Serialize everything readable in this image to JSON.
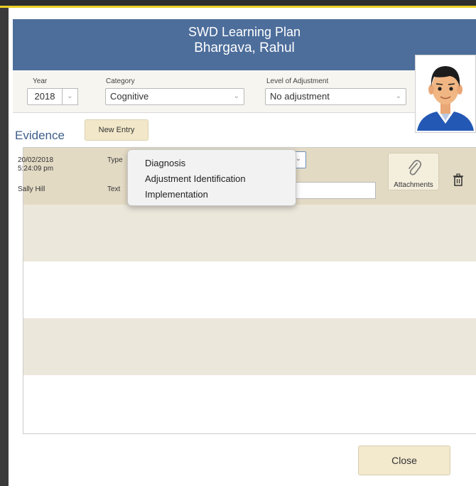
{
  "header": {
    "title": "SWD Learning Plan",
    "student_name": "Bhargava, Rahul"
  },
  "filters": {
    "year_label": "Year",
    "year_value": "2018",
    "category_label": "Category",
    "category_value": "Cognitive",
    "level_label": "Level of Adjustment",
    "level_value": "No adjustment"
  },
  "evidence": {
    "section_label": "Evidence",
    "new_entry_label": "New Entry",
    "entries": [
      {
        "date": "20/02/2018",
        "time": "5:24:09 pm",
        "user": "Sally Hill",
        "type_label": "Type",
        "text_label": "Text",
        "attachments_label": "Attachments"
      }
    ]
  },
  "type_dropdown": {
    "options": [
      "Diagnosis",
      "Adjustment Identification",
      "Implementation"
    ]
  },
  "footer": {
    "close_label": "Close"
  },
  "colors": {
    "header_bg": "#4d6e9b",
    "button_bg": "#f3e9cd",
    "accent_top": "#e9cf27",
    "row_highlight": "#e3dac4"
  },
  "icons": [
    "chevron-down-icon",
    "paperclip-icon",
    "trash-icon",
    "student-avatar"
  ]
}
